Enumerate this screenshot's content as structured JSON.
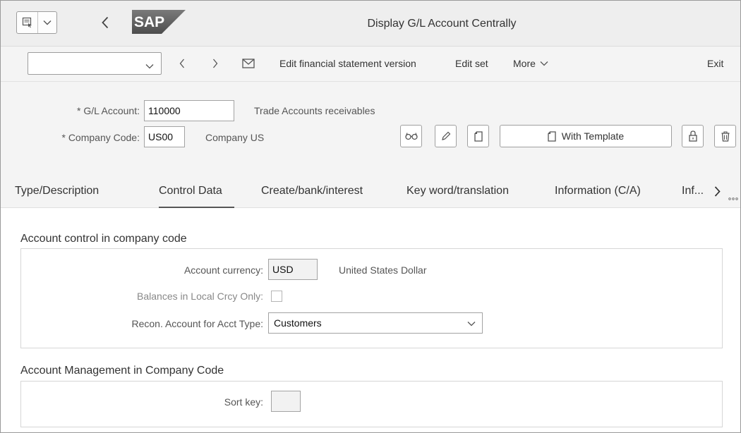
{
  "window": {
    "title": "Display G/L Account Centrally",
    "logo_text": "SAP"
  },
  "toolbar": {
    "select_value": "",
    "edit_fsv_label": "Edit financial statement version",
    "edit_set_label": "Edit set",
    "more_label": "More",
    "exit_label": "Exit"
  },
  "header": {
    "gl_account_label": "* G/L Account:",
    "gl_account_value": "110000",
    "gl_account_desc": "Trade Accounts receivables",
    "company_code_label": "* Company Code:",
    "company_code_value": "US00",
    "company_code_desc": "Company US",
    "with_template_label": "With Template"
  },
  "tabs": [
    {
      "label": "Type/Description"
    },
    {
      "label": "Control Data",
      "selected": true
    },
    {
      "label": "Create/bank/interest"
    },
    {
      "label": "Key word/translation"
    },
    {
      "label": "Information (C/A)"
    },
    {
      "label": "Inf..."
    }
  ],
  "account_control": {
    "title": "Account control in company code",
    "currency_label": "Account currency:",
    "currency_value": "USD",
    "currency_desc": "United States Dollar",
    "local_crcy_label": "Balances in Local Crcy Only:",
    "local_crcy_checked": false,
    "recon_label": "Recon. Account for Acct Type:",
    "recon_value": "Customers"
  },
  "account_management": {
    "title": "Account Management in Company Code",
    "sort_key_label": "Sort key:",
    "sort_key_value": ""
  },
  "icons": {
    "menu": "menu-icon",
    "back": "back-icon",
    "prev": "previous-icon",
    "next": "next-icon",
    "mail": "envelope-icon",
    "glasses": "display-icon",
    "pencil": "edit-icon",
    "copy": "copy-icon",
    "lock": "lock-icon",
    "trash": "delete-icon"
  },
  "colors": {
    "sap_blue": "#0a6ed1",
    "background": "#f4f4f4"
  }
}
